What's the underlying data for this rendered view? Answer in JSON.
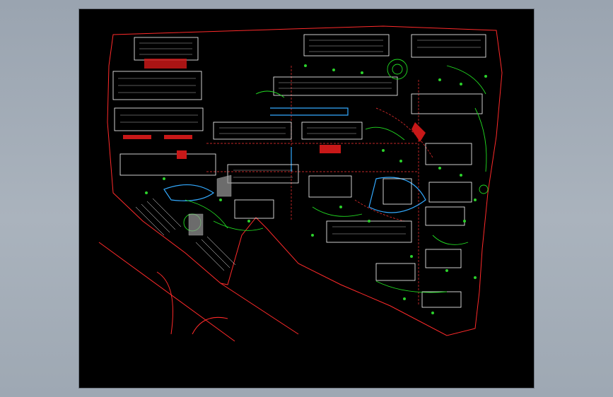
{
  "drawing": {
    "viewport_background": "#000000",
    "page_background": "#a3adb8",
    "layer_colors": {
      "boundary": "#ff2a2a",
      "buildings": "#ffffff",
      "landscape": "#22dd22",
      "water": "#33aaff",
      "roads": "#ff3333",
      "plaza": "#c8c8c8"
    }
  }
}
